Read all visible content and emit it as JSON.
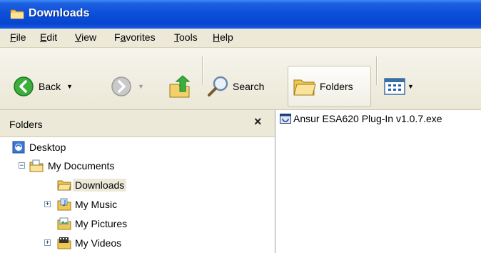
{
  "window": {
    "title": "Downloads"
  },
  "menu": [
    {
      "label": "File",
      "accel": "F",
      "rest": "ile"
    },
    {
      "label": "Edit",
      "accel": "E",
      "rest": "dit"
    },
    {
      "label": "View",
      "accel": "V",
      "rest": "iew"
    },
    {
      "label": "Favorites",
      "accel": "a",
      "pre": "F",
      "rest": "vorites"
    },
    {
      "label": "Tools",
      "accel": "T",
      "rest": "ools"
    },
    {
      "label": "Help",
      "accel": "H",
      "rest": "elp"
    }
  ],
  "toolbar": {
    "back_label": "Back",
    "search_label": "Search",
    "folders_label": "Folders"
  },
  "folders_pane": {
    "title": "Folders",
    "close": "×",
    "items": [
      {
        "label": "Desktop"
      },
      {
        "label": "My Documents"
      },
      {
        "label": "Downloads"
      },
      {
        "label": "My Music"
      },
      {
        "label": "My Pictures"
      },
      {
        "label": "My Videos"
      }
    ]
  },
  "files": [
    {
      "name": "Ansur ESA620 Plug-In v1.0.7.exe"
    }
  ]
}
